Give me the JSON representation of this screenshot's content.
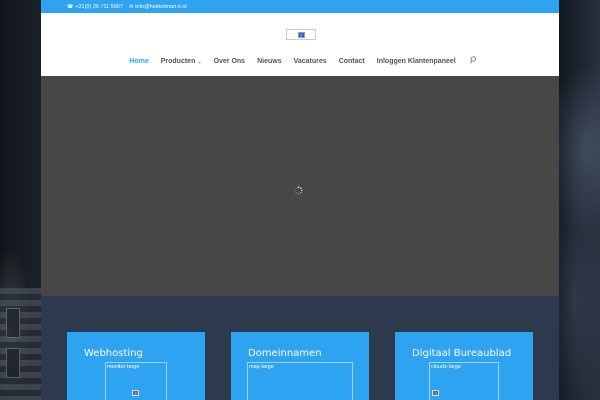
{
  "topbar": {
    "phone": "+31(0) 26 711 5067",
    "email": "info@hekkelman-it.nl",
    "phone_icon": "phone-icon",
    "email_icon": "envelope-icon",
    "background": "#2ea3f2"
  },
  "logo": {
    "alt": "?"
  },
  "nav": {
    "items": [
      {
        "label": "Home",
        "active": true
      },
      {
        "label": "Producten",
        "has_dropdown": true
      },
      {
        "label": "Over Ons"
      },
      {
        "label": "Nieuws"
      },
      {
        "label": "Vacatures"
      },
      {
        "label": "Contact"
      },
      {
        "label": "Inloggen Klantenpaneel"
      }
    ],
    "search_icon": "search-icon",
    "accent": "#2ea3f2"
  },
  "hero": {
    "background": "#474747",
    "loader_icon": "spinner-icon"
  },
  "services": {
    "cards": [
      {
        "title": "Webhosting",
        "image_alt": "monitor-large",
        "broken_icon": "?"
      },
      {
        "title": "Domeinnamen",
        "image_alt": "map-large"
      },
      {
        "title": "Digitaal Bureaublad",
        "image_alt": "clouds-large",
        "broken_icon": "?"
      }
    ]
  }
}
